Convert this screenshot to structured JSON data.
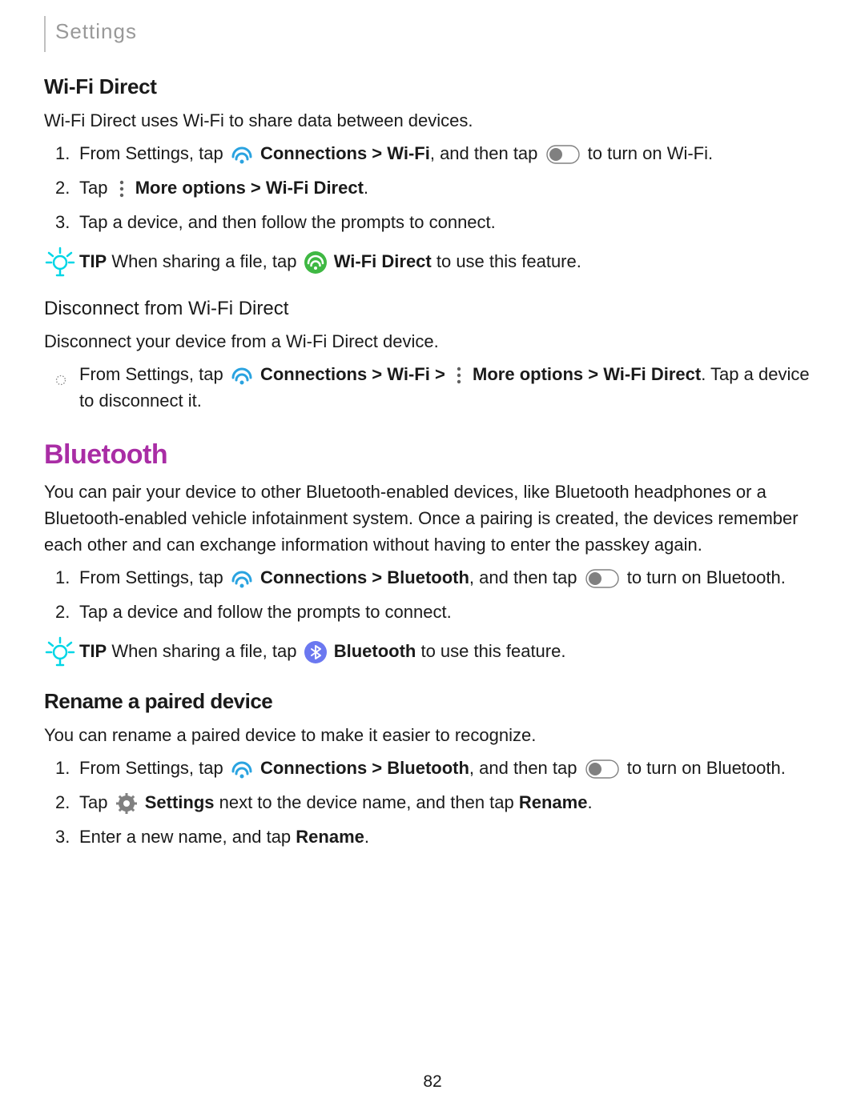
{
  "header": "Settings",
  "pageNumber": "82",
  "wifiDirect": {
    "title": "Wi-Fi Direct",
    "intro": "Wi-Fi Direct uses Wi-Fi to share data between devices.",
    "step1_a": "From Settings, tap ",
    "step1_b": " Connections > Wi-Fi",
    "step1_c": ", and then tap ",
    "step1_d": " to turn on Wi-Fi.",
    "step2_a": "Tap ",
    "step2_b": " More options > Wi-Fi Direct",
    "step2_c": ".",
    "step3": "Tap a device, and then follow the prompts to connect.",
    "tip_label": "TIP",
    "tip_a": " When sharing a file, tap ",
    "tip_b": " Wi-Fi Direct",
    "tip_c": " to use this feature."
  },
  "disconnect": {
    "title": "Disconnect from Wi-Fi Direct",
    "intro": "Disconnect your device from a Wi-Fi Direct device.",
    "step1_a": "From Settings, tap ",
    "step1_b": " Connections > Wi-Fi > ",
    "step1_c": " More options > Wi-Fi Direct",
    "step1_d": ". Tap a device to disconnect it."
  },
  "bluetooth": {
    "title": "Bluetooth",
    "intro": "You can pair your device to other Bluetooth-enabled devices, like Bluetooth headphones or a Bluetooth-enabled vehicle infotainment system. Once a pairing is created, the devices remember each other and can exchange information without having to enter the passkey again.",
    "step1_a": "From Settings, tap ",
    "step1_b": " Connections > Bluetooth",
    "step1_c": ", and then tap ",
    "step1_d": " to turn on Bluetooth.",
    "step2": "Tap a device and follow the prompts to connect.",
    "tip_label": "TIP",
    "tip_a": " When sharing a file, tap ",
    "tip_b": " Bluetooth",
    "tip_c": " to use this feature."
  },
  "rename": {
    "title": "Rename a paired device",
    "intro": "You can rename a paired device to make it easier to recognize.",
    "step1_a": "From Settings, tap ",
    "step1_b": " Connections > Bluetooth",
    "step1_c": ", and then tap ",
    "step1_d": " to turn on Bluetooth.",
    "step2_a": "Tap ",
    "step2_b": " Settings",
    "step2_c": " next to the device name, and then tap ",
    "step2_d": "Rename",
    "step2_e": ".",
    "step3_a": "Enter a new name, and tap ",
    "step3_b": "Rename",
    "step3_c": "."
  }
}
